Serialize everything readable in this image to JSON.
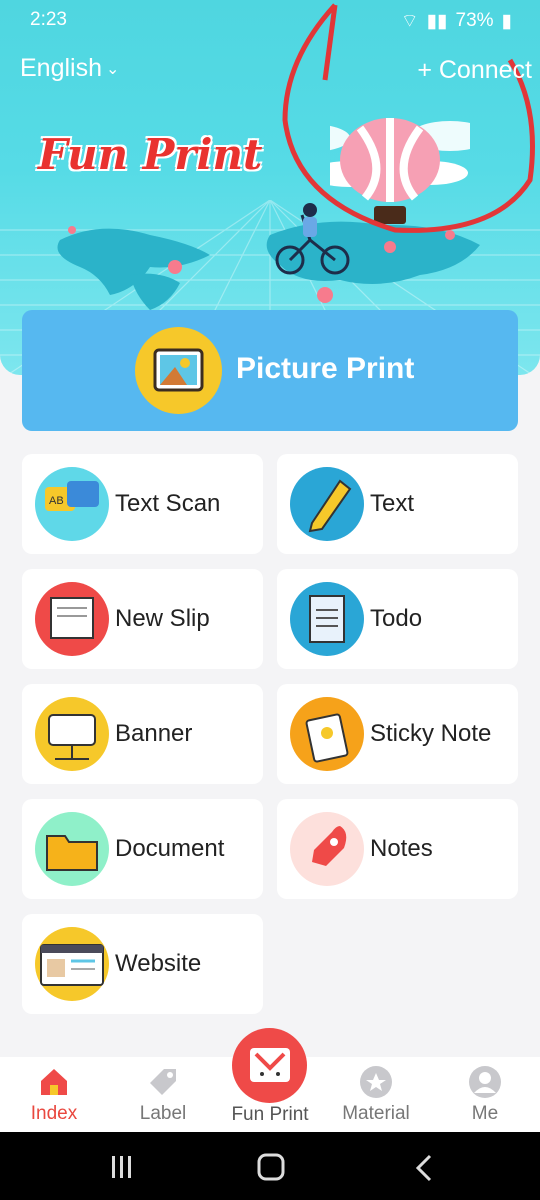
{
  "status_bar": {
    "time": "2:23",
    "battery": "73%"
  },
  "header": {
    "language": "English",
    "connect": "+ Connect",
    "logo_text": "Fun Print"
  },
  "picture_print": {
    "label": "Picture Print"
  },
  "features": [
    {
      "label": "Text Scan",
      "icon": "text-scan-icon",
      "color": "#5fd8e8"
    },
    {
      "label": "Text",
      "icon": "pencil-icon",
      "color": "#2aa6d6"
    },
    {
      "label": "New Slip",
      "icon": "slip-icon",
      "color": "#ef4a48"
    },
    {
      "label": "Todo",
      "icon": "todo-icon",
      "color": "#2aa6d6"
    },
    {
      "label": "Banner",
      "icon": "banner-icon",
      "color": "#f6c82a"
    },
    {
      "label": "Sticky Note",
      "icon": "sticky-note-icon",
      "color": "#f6a21a"
    },
    {
      "label": "Document",
      "icon": "folder-icon",
      "color": "#8ff0c9"
    },
    {
      "label": "Notes",
      "icon": "rocket-icon",
      "color": "#fde0dc"
    },
    {
      "label": "Website",
      "icon": "website-icon",
      "color": "#f6c82a"
    }
  ],
  "nav": {
    "index": "Index",
    "label": "Label",
    "fun_print": "Fun Print",
    "material": "Material",
    "me": "Me"
  }
}
